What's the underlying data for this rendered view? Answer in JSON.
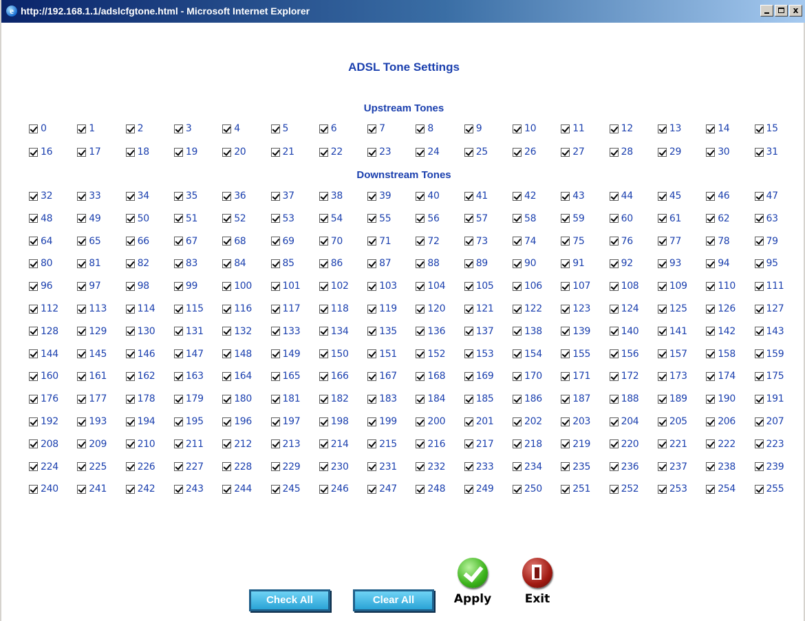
{
  "window": {
    "title": "http://192.168.1.1/adslcfgtone.html - Microsoft Internet Explorer",
    "buttons": {
      "minimize": "_",
      "maximize": "□",
      "close": "x"
    }
  },
  "page": {
    "title": "ADSL Tone Settings",
    "upstream_title": "Upstream Tones",
    "downstream_title": "Downstream Tones",
    "tones": {
      "first": 0,
      "last": 255,
      "upstream_last": 31,
      "all_checked": true
    }
  },
  "actions": {
    "check_all": "Check All",
    "clear_all": "Clear All",
    "apply": "Apply",
    "exit": "Exit"
  },
  "colors": {
    "label_blue": "#1a3fae",
    "titlebar_start": "#0a246a",
    "button_blue": "#2aa3d6",
    "apply_green": "#3bb21a",
    "exit_red": "#a11a12"
  }
}
